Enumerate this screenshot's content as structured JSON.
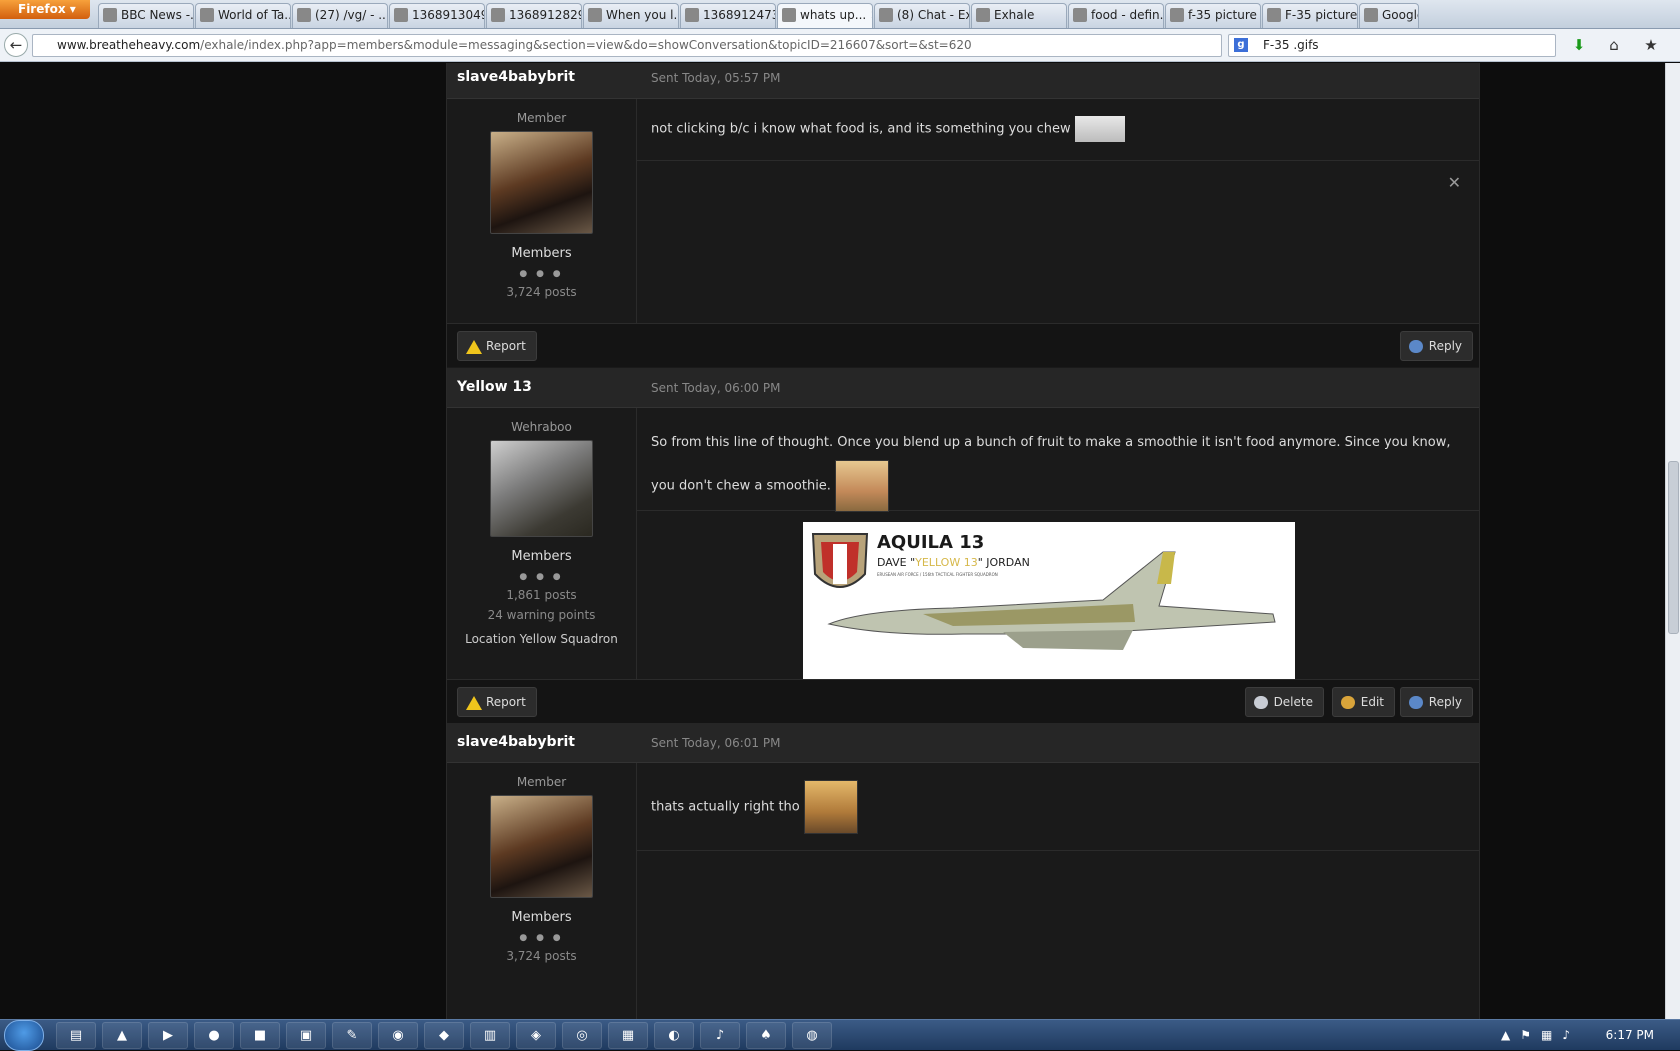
{
  "browser": {
    "firefox_label": "Firefox",
    "tabs": [
      {
        "label": "BBC News -..."
      },
      {
        "label": "World of Ta..."
      },
      {
        "label": "(27) /vg/ - ..."
      },
      {
        "label": "1368913049..."
      },
      {
        "label": "1368912829..."
      },
      {
        "label": "When you l..."
      },
      {
        "label": "1368912473..."
      },
      {
        "label": "whats up..."
      },
      {
        "label": "(8) Chat - Ex..."
      },
      {
        "label": "Exhale"
      },
      {
        "label": "food - defin..."
      },
      {
        "label": "f-35 picture ..."
      },
      {
        "label": "F-35 picture..."
      },
      {
        "label": "Google I"
      }
    ],
    "url_domain": "www.breatheheavy.com",
    "url_path": "/exhale/index.php?app=members&module=messaging&section=view&do=showConversation&topicID=216607&sort=&st=620",
    "search_value": "F-35 .gifs",
    "search_engine_letter": "g"
  },
  "posts": [
    {
      "author": "slave4babybrit",
      "sent": "Sent Today, 05:57 PM",
      "rank": "Member",
      "group": "Members",
      "pips": "● ● ●",
      "posts": "3,724 posts",
      "message": "not clicking b/c i know what food is, and its something you chew",
      "report_label": "Report",
      "reply_label": "Reply"
    },
    {
      "author": "Yellow 13",
      "sent": "Sent Today, 06:00 PM",
      "rank": "Wehraboo",
      "group": "Members",
      "pips": "● ● ●",
      "posts": "1,861 posts",
      "warnings": "24 warning points",
      "location": "Location Yellow Squadron",
      "message": "So from this line of thought. Once you blend up a bunch of fruit to make a smoothie it isn't food anymore. Since you know, you don't chew a smoothie.",
      "image": {
        "title": "AQUILA 13",
        "subtitle_pre": "DAVE \"",
        "subtitle_callsign": "YELLOW 13",
        "subtitle_post": "\" JORDAN",
        "caption": "ERUSEAN AIR FORCE / 156th TACTICAL FIGHTER SQUADRON"
      },
      "report_label": "Report",
      "delete_label": "Delete",
      "edit_label": "Edit",
      "reply_label": "Reply"
    },
    {
      "author": "slave4babybrit",
      "sent": "Sent Today, 06:01 PM",
      "rank": "Member",
      "group": "Members",
      "pips": "● ● ●",
      "posts": "3,724 posts",
      "message": "thats actually right tho"
    }
  ],
  "taskbar": {
    "clock": "6:17 PM"
  },
  "colors": {
    "page_bg": "#0d0d0d",
    "post_bg": "#1a1a1a",
    "header_bg": "#262626",
    "warning_icon": "#f0c51c",
    "bubble_icon": "#5b88c8",
    "firefox_button": "#e07018"
  }
}
